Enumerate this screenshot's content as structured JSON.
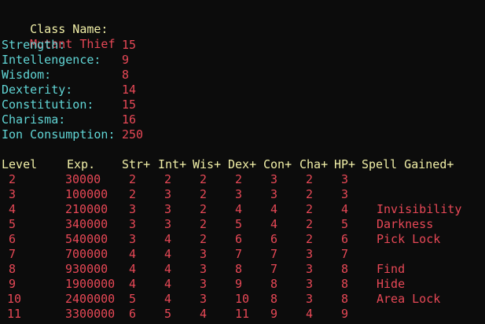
{
  "class_line": {
    "label": "Class Name:",
    "value": "Mutant Thief"
  },
  "stats": [
    {
      "label": "Strength:",
      "value": "15"
    },
    {
      "label": "Intellengence:",
      "value": "9"
    },
    {
      "label": "Wisdom:",
      "value": "8"
    },
    {
      "label": "Dexterity:",
      "value": "14"
    },
    {
      "label": "Constitution:",
      "value": "15"
    },
    {
      "label": "Charisma:",
      "value": "16"
    },
    {
      "label": "Ion Consumption:",
      "value": "250"
    }
  ],
  "table": {
    "headers": {
      "level": "Level",
      "exp": "Exp.",
      "str": "Str+",
      "int": "Int+",
      "wis": "Wis+",
      "dex": "Dex+",
      "con": "Con+",
      "cha": "Cha+",
      "hp": "HP+",
      "spell": "Spell Gained+"
    },
    "rows": [
      {
        "level": "2",
        "exp": "30000",
        "str": "2",
        "int": "2",
        "wis": "2",
        "dex": "2",
        "con": "3",
        "cha": "2",
        "hp": "3",
        "spell": ""
      },
      {
        "level": "3",
        "exp": "100000",
        "str": "2",
        "int": "3",
        "wis": "2",
        "dex": "3",
        "con": "3",
        "cha": "2",
        "hp": "3",
        "spell": ""
      },
      {
        "level": "4",
        "exp": "210000",
        "str": "3",
        "int": "3",
        "wis": "2",
        "dex": "4",
        "con": "4",
        "cha": "2",
        "hp": "4",
        "spell": "Invisibility"
      },
      {
        "level": "5",
        "exp": "340000",
        "str": "3",
        "int": "3",
        "wis": "2",
        "dex": "5",
        "con": "4",
        "cha": "2",
        "hp": "5",
        "spell": "Darkness"
      },
      {
        "level": "6",
        "exp": "540000",
        "str": "3",
        "int": "4",
        "wis": "2",
        "dex": "6",
        "con": "6",
        "cha": "2",
        "hp": "6",
        "spell": "Pick Lock"
      },
      {
        "level": "7",
        "exp": "700000",
        "str": "4",
        "int": "4",
        "wis": "3",
        "dex": "7",
        "con": "7",
        "cha": "3",
        "hp": "7",
        "spell": ""
      },
      {
        "level": "8",
        "exp": "930000",
        "str": "4",
        "int": "4",
        "wis": "3",
        "dex": "8",
        "con": "7",
        "cha": "3",
        "hp": "8",
        "spell": "Find"
      },
      {
        "level": "9",
        "exp": "1900000",
        "str": "4",
        "int": "4",
        "wis": "3",
        "dex": "9",
        "con": "8",
        "cha": "3",
        "hp": "8",
        "spell": "Hide"
      },
      {
        "level": "10",
        "exp": "2400000",
        "str": "5",
        "int": "4",
        "wis": "3",
        "dex": "10",
        "con": "8",
        "cha": "3",
        "hp": "8",
        "spell": "Area Lock"
      },
      {
        "level": "11",
        "exp": "3300000",
        "str": "6",
        "int": "5",
        "wis": "4",
        "dex": "11",
        "con": "9",
        "cha": "4",
        "hp": "9",
        "spell": ""
      }
    ]
  },
  "colors": {
    "background": "#0c0c0c",
    "label_yellow": "#f2f0a8",
    "label_cyan": "#61d6d6",
    "value_red": "#e74856"
  }
}
